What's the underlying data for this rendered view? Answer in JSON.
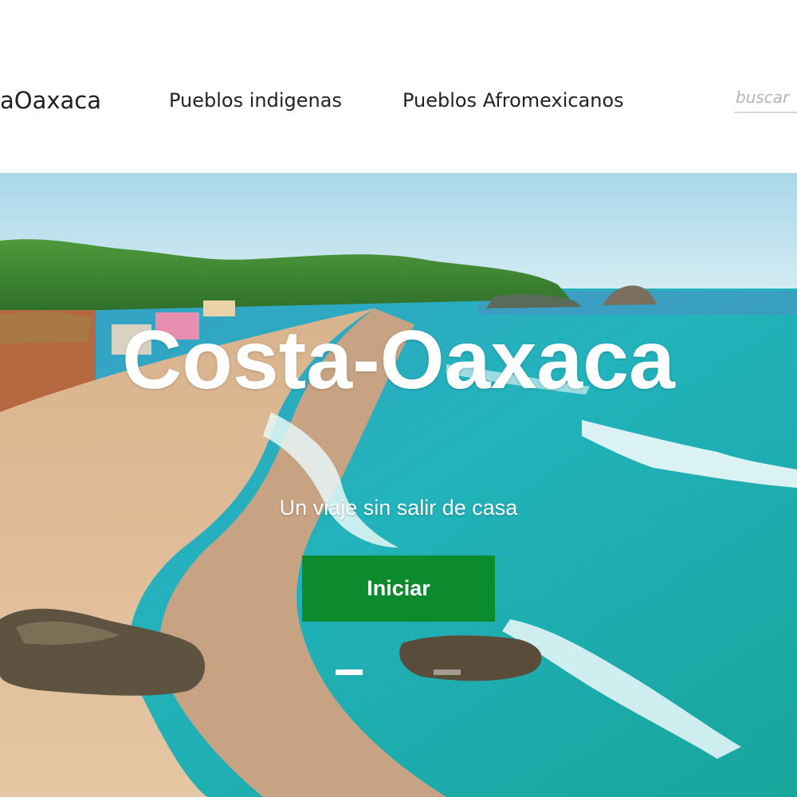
{
  "header": {
    "brand": "aOaxaca",
    "nav": [
      {
        "label": "Pueblos indigenas"
      },
      {
        "label": "Pueblos Afromexicanos"
      }
    ],
    "search": {
      "placeholder": "buscar",
      "value": ""
    }
  },
  "hero": {
    "title": "Costa-Oaxaca",
    "subtitle": "Un viaje sin salir de casa",
    "button_label": "Iniciar",
    "slides": {
      "total": 2,
      "active": 1
    }
  },
  "colors": {
    "button": "#0c8a2e",
    "sky": "#bfe3f0",
    "sea": "#1fa6b4",
    "sand": "#d9b28a"
  }
}
